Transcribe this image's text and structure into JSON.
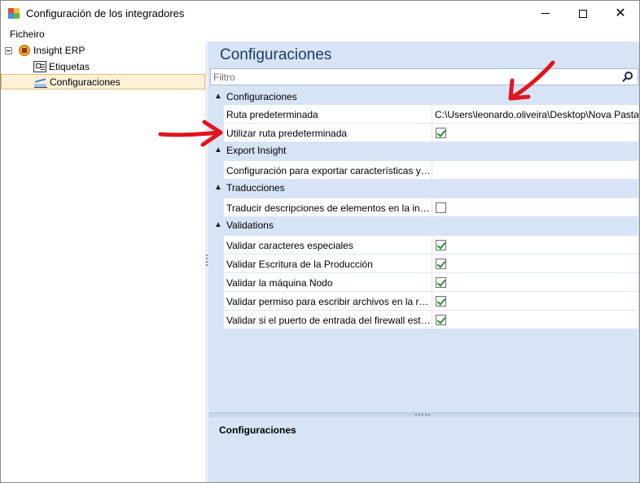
{
  "window": {
    "title": "Configuración de los integradores"
  },
  "menu": {
    "items": [
      "Ficheiro"
    ]
  },
  "tree": {
    "root_label": "Insight ERP",
    "children": [
      {
        "label": "Etiquetas"
      },
      {
        "label": "Configuraciones"
      }
    ]
  },
  "panel": {
    "title": "Configuraciones",
    "filter_placeholder": "Filtro"
  },
  "property_grid": {
    "categories": [
      {
        "label": "Configuraciones",
        "rows": [
          {
            "name": "Ruta predeterminada",
            "value": "C:\\Users\\leonardo.oliveira\\Desktop\\Nova Pasta"
          },
          {
            "name": "Utilizar ruta predeterminada",
            "checked": true
          }
        ]
      },
      {
        "label": "Export Insight",
        "rows": [
          {
            "name": "Configuración para exportar características y gru...",
            "value": ""
          }
        ]
      },
      {
        "label": "Traducciones",
        "rows": [
          {
            "name": "Traducir descripciones de elementos en la integr...",
            "checked": false
          }
        ]
      },
      {
        "label": "Validations",
        "rows": [
          {
            "name": "Validar caracteres especiales",
            "checked": true
          },
          {
            "name": "Validar Escritura de la Producción",
            "checked": true
          },
          {
            "name": "Validar la máquina Nodo",
            "checked": true
          },
          {
            "name": "Validar permiso para escribir archivos en la ruta...",
            "checked": true
          },
          {
            "name": "Validar si el puerto de entrada del firewall está a...",
            "checked": true
          }
        ]
      }
    ]
  },
  "description": {
    "title": "Configuraciones"
  },
  "colors": {
    "panel_bg": "#d6e4f5",
    "title_blue": "#1e3a64",
    "selection_bg": "#fdf1d8",
    "selection_border": "#e7b96a",
    "annotation_red": "#e0141e",
    "check_green": "#2f8a2f"
  }
}
